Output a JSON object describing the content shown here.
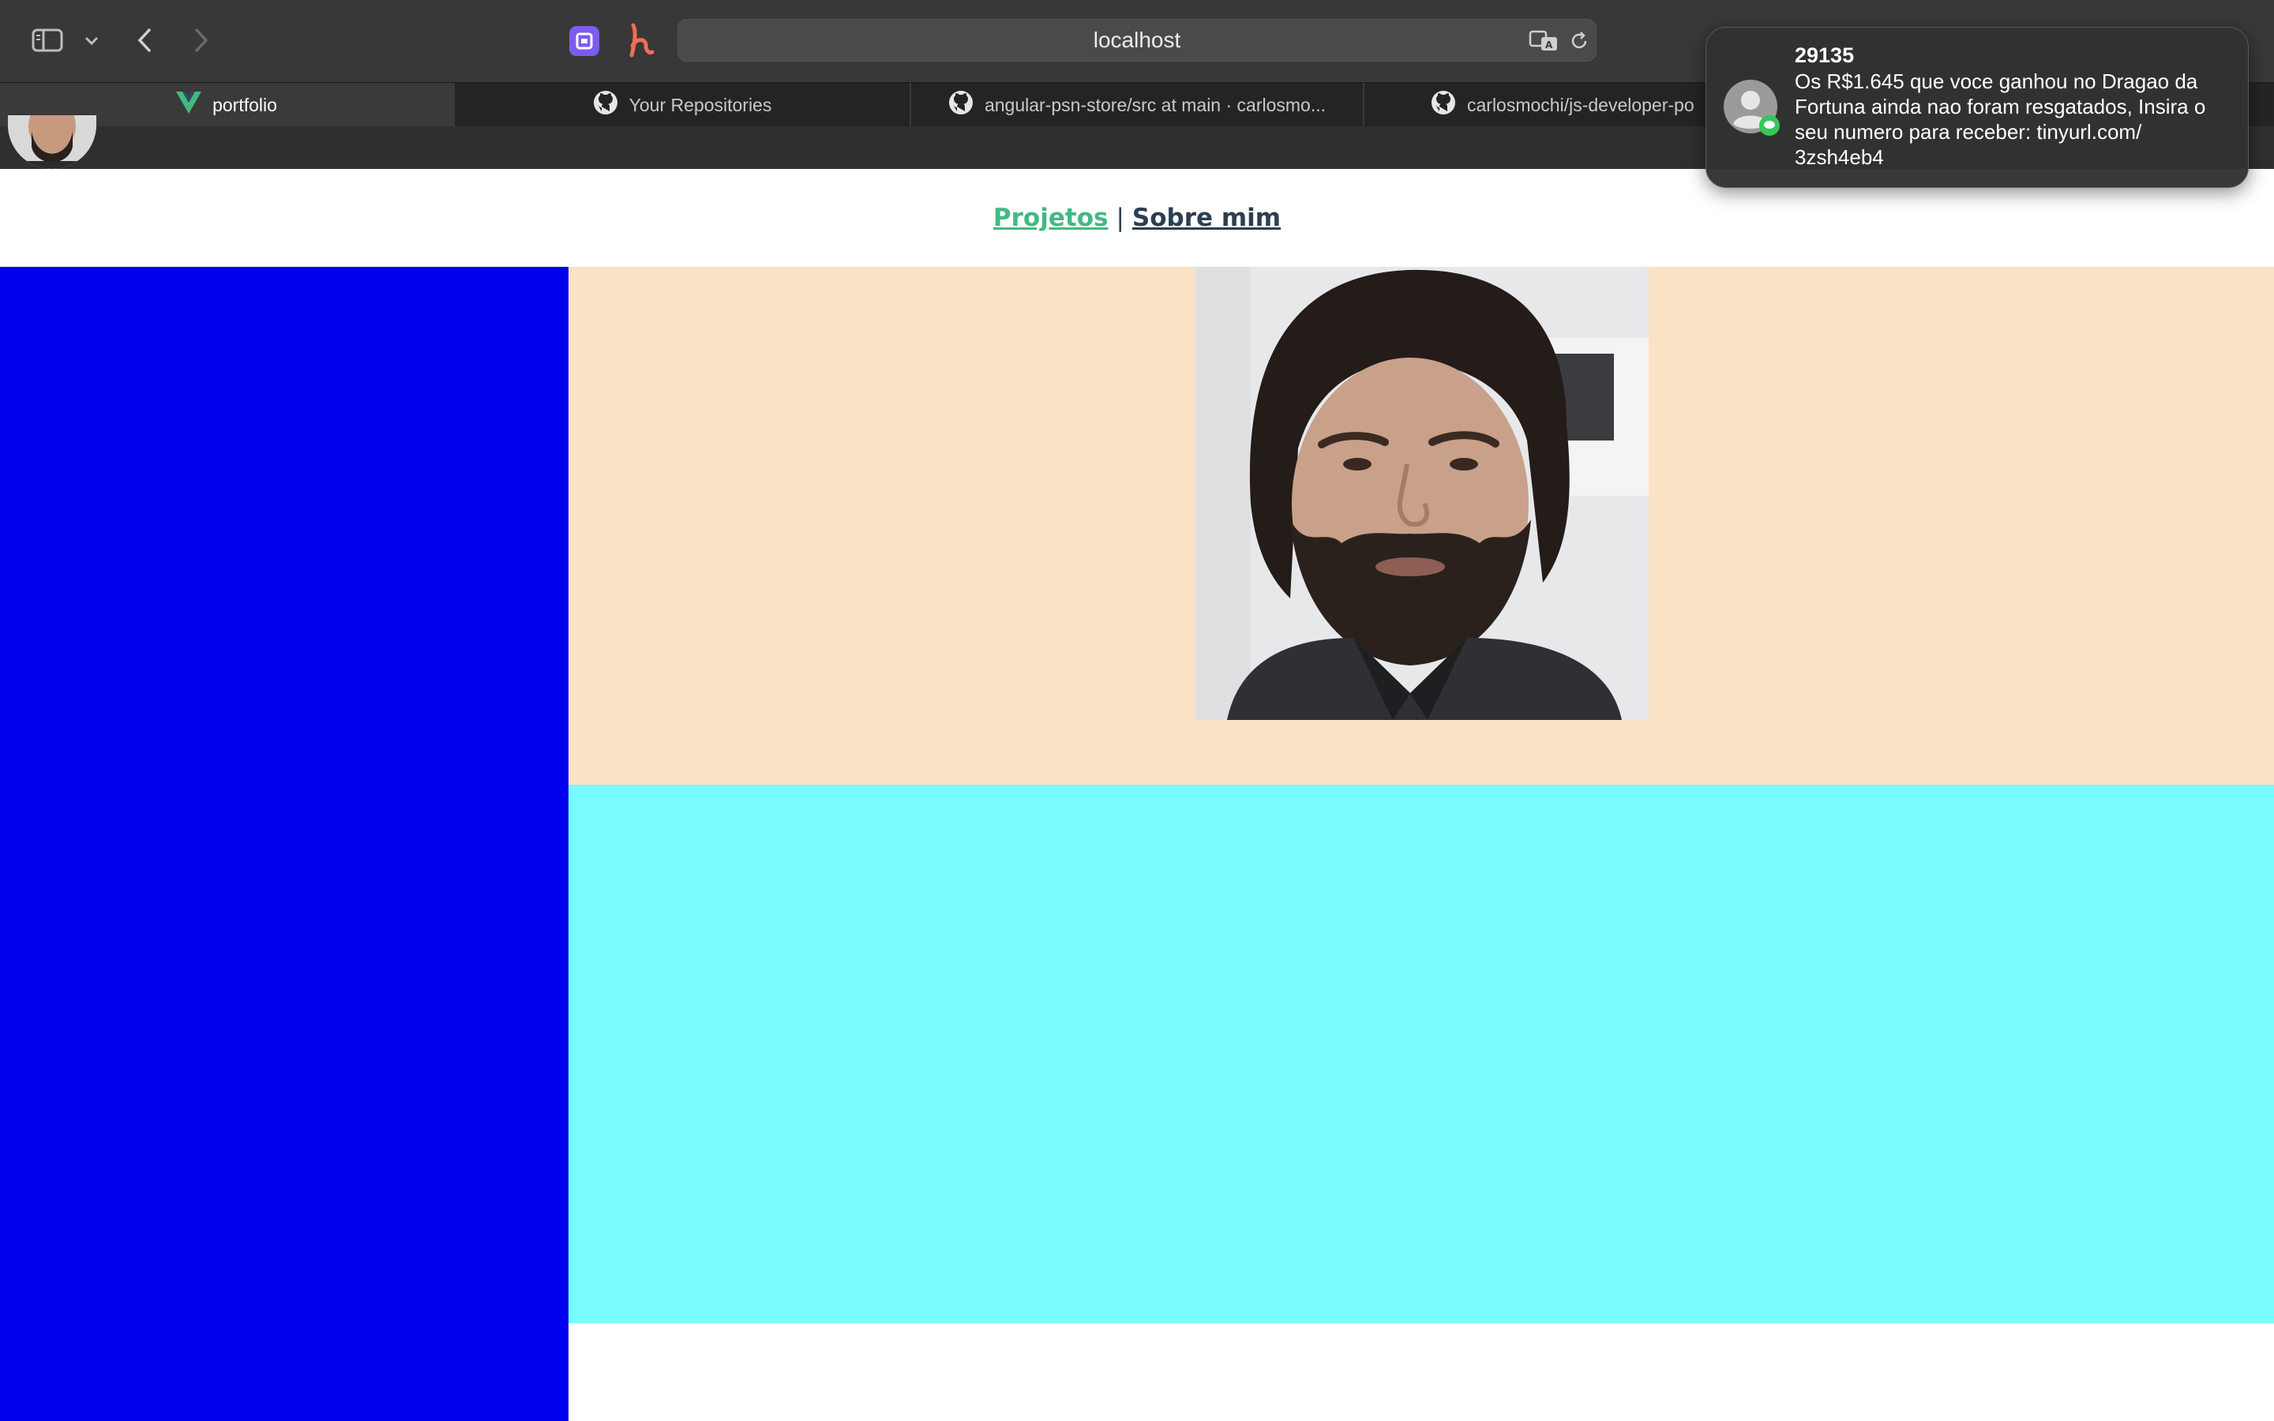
{
  "browser": {
    "url": "localhost",
    "tabs": [
      {
        "label": "portfolio",
        "icon": "vue-logo-icon",
        "active": true
      },
      {
        "label": "Your Repositories",
        "icon": "github-icon",
        "active": false
      },
      {
        "label": "angular-psn-store/src at main · carlosmo...",
        "icon": "github-icon",
        "active": false
      },
      {
        "label": "carlosmochi/js-developer-po",
        "icon": "github-icon",
        "active": false
      }
    ]
  },
  "page": {
    "nav": {
      "projetos": "Projetos",
      "separator": "|",
      "sobre": "Sobre mim"
    },
    "colors": {
      "sidebar": "#0000ee",
      "hero": "#fae2c6",
      "lower": "#78fbfc",
      "nav_active": "#42b983",
      "nav_text": "#2c3e50"
    }
  },
  "notification": {
    "sender": "29135",
    "message": "Os R$1.645 que voce ganhou no Dragao da Fortuna ainda nao foram resgatados, Insira o seu numero para receber: tinyurl.com/ 3zsh4eb4"
  }
}
